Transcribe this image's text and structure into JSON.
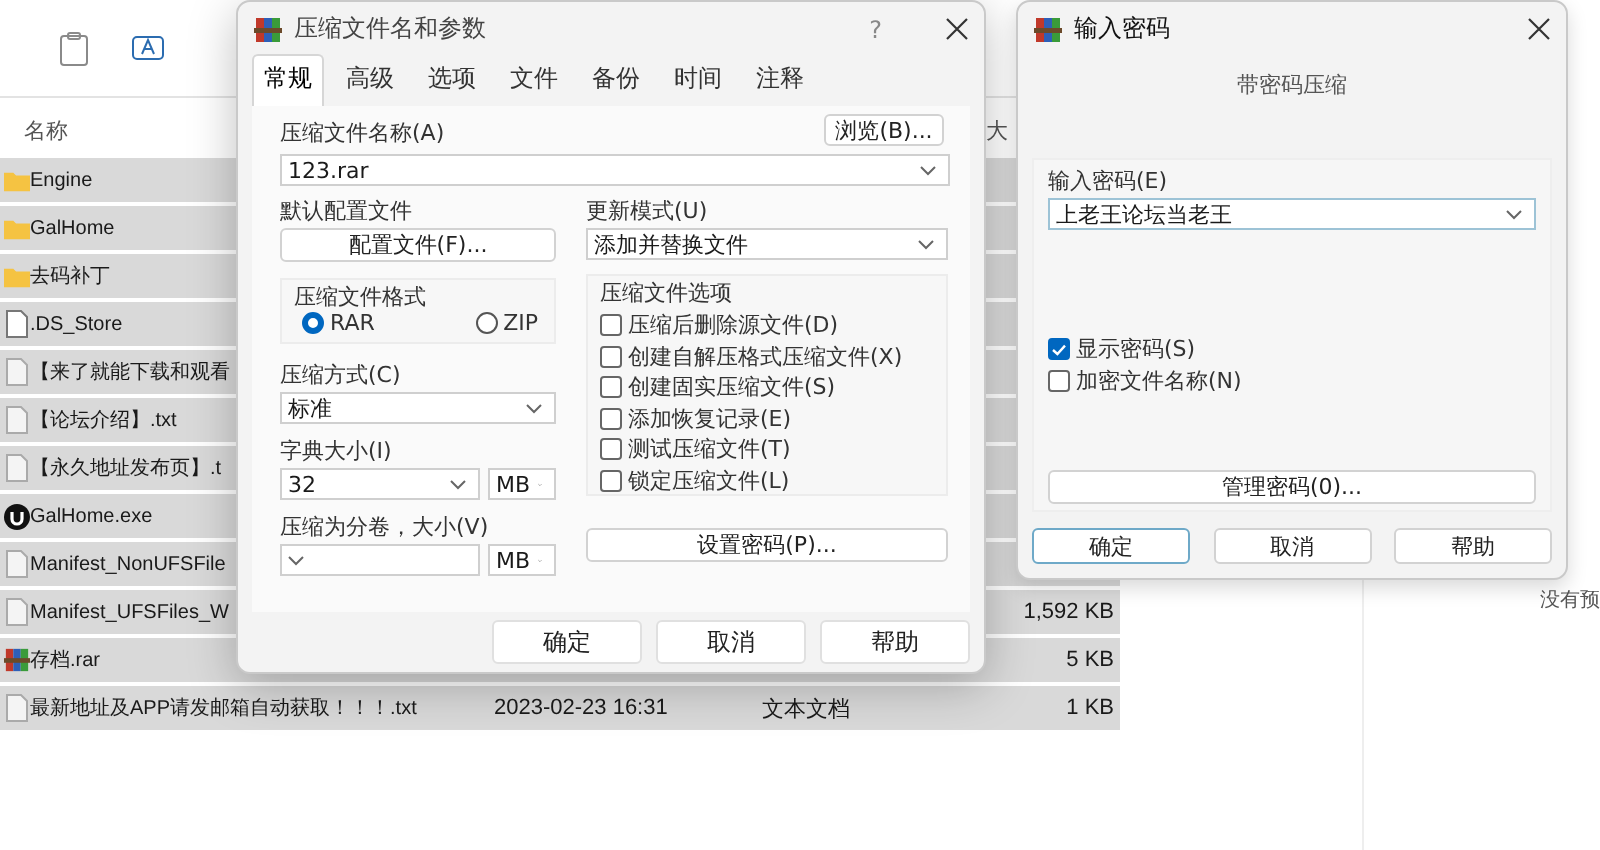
{
  "explorer": {
    "columns": [
      "名称",
      "大"
    ],
    "rows": [
      {
        "kind": "folder",
        "name": "Engine",
        "selected": true
      },
      {
        "kind": "folder",
        "name": "GalHome",
        "selected": true
      },
      {
        "kind": "folder",
        "name": "去码补丁",
        "selected": true
      },
      {
        "kind": "file",
        "name": ".DS_Store",
        "selected": true
      },
      {
        "kind": "text",
        "name": "【来了就能下载和观看",
        "selected": true
      },
      {
        "kind": "text",
        "name": "【论坛介绍】.txt",
        "selected": true
      },
      {
        "kind": "text",
        "name": "【永久地址发布页】.t",
        "selected": true
      },
      {
        "kind": "exe",
        "name": "GalHome.exe",
        "selected": true
      },
      {
        "kind": "text",
        "name": "Manifest_NonUFSFile",
        "selected": true
      },
      {
        "kind": "text",
        "name": "Manifest_UFSFiles_W",
        "size": "1,592 KB",
        "selected": true
      },
      {
        "kind": "rar",
        "name": "存档.rar",
        "size": "5 KB",
        "selected": true
      },
      {
        "kind": "text",
        "name": "最新地址及APP请发邮箱自动获取！！！.txt",
        "date": "2023-02-23 16:31",
        "type": "文本文档",
        "size": "1 KB",
        "selected": true
      }
    ],
    "preview_text": "没有预"
  },
  "archive_dialog": {
    "title": "压缩文件名和参数",
    "help": "?",
    "tabs": [
      {
        "label": "常规",
        "selected": true
      },
      {
        "label": "高级",
        "selected": false
      },
      {
        "label": "选项",
        "selected": false
      },
      {
        "label": "文件",
        "selected": false
      },
      {
        "label": "备份",
        "selected": false
      },
      {
        "label": "时间",
        "selected": false
      },
      {
        "label": "注释",
        "selected": false
      }
    ],
    "archive_name": {
      "label": "压缩文件名称(A)",
      "value": "123.rar",
      "browse": "浏览(B)..."
    },
    "profiles": {
      "label": "默认配置文件",
      "button": "配置文件(F)..."
    },
    "update_mode": {
      "label": "更新模式(U)",
      "value": "添加并替换文件"
    },
    "format": {
      "title": "压缩文件格式",
      "options": [
        {
          "label": "RAR",
          "selected": true
        },
        {
          "label": "ZIP",
          "selected": false
        }
      ]
    },
    "method": {
      "label": "压缩方式(C)",
      "value": "标准"
    },
    "dictionary": {
      "label": "字典大小(I)",
      "value": "32",
      "unit": "MB"
    },
    "volume": {
      "label": "压缩为分卷，大小(V)",
      "unit": "MB"
    },
    "options": {
      "title": "压缩文件选项",
      "items": [
        {
          "label": "压缩后删除源文件(D)",
          "checked": false
        },
        {
          "label": "创建自解压格式压缩文件(X)",
          "checked": false
        },
        {
          "label": "创建固实压缩文件(S)",
          "checked": false
        },
        {
          "label": "添加恢复记录(E)",
          "checked": false
        },
        {
          "label": "测试压缩文件(T)",
          "checked": false
        },
        {
          "label": "锁定压缩文件(L)",
          "checked": false
        }
      ]
    },
    "set_password": "设置密码(P)...",
    "buttons": [
      "确定",
      "取消",
      "帮助"
    ]
  },
  "password_dialog": {
    "title": "输入密码",
    "subtitle": "带密码压缩",
    "password": {
      "label": "输入密码(E)",
      "value": "上老王论坛当老王"
    },
    "options": [
      {
        "label": "显示密码(S)",
        "checked": true
      },
      {
        "label": "加密文件名称(N)",
        "checked": false
      }
    ],
    "manage": "管理密码(0)...",
    "buttons": [
      {
        "label": "确定",
        "focused": true
      },
      {
        "label": "取消",
        "focused": false
      },
      {
        "label": "帮助",
        "focused": false
      }
    ]
  }
}
